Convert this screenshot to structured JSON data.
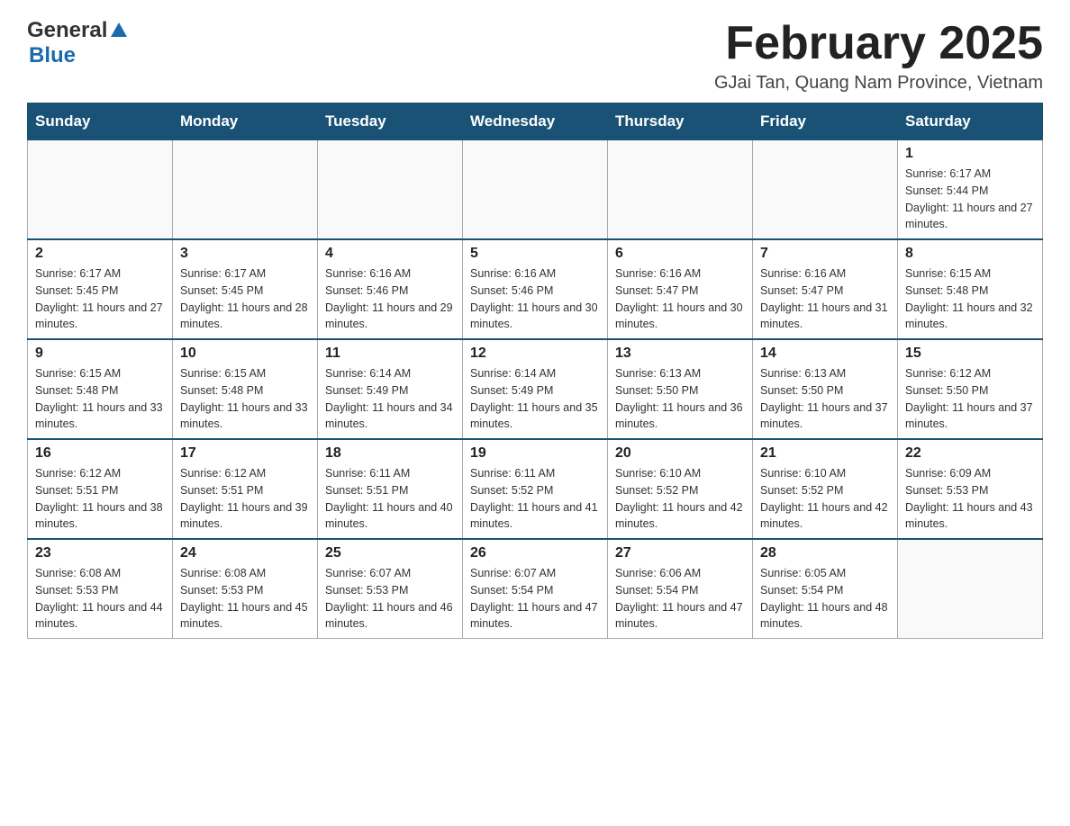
{
  "header": {
    "logo_general": "General",
    "logo_blue": "Blue",
    "title": "February 2025",
    "location": "GJai Tan, Quang Nam Province, Vietnam"
  },
  "days_of_week": [
    "Sunday",
    "Monday",
    "Tuesday",
    "Wednesday",
    "Thursday",
    "Friday",
    "Saturday"
  ],
  "weeks": [
    {
      "days": [
        {
          "number": "",
          "info": ""
        },
        {
          "number": "",
          "info": ""
        },
        {
          "number": "",
          "info": ""
        },
        {
          "number": "",
          "info": ""
        },
        {
          "number": "",
          "info": ""
        },
        {
          "number": "",
          "info": ""
        },
        {
          "number": "1",
          "info": "Sunrise: 6:17 AM\nSunset: 5:44 PM\nDaylight: 11 hours and 27 minutes."
        }
      ]
    },
    {
      "days": [
        {
          "number": "2",
          "info": "Sunrise: 6:17 AM\nSunset: 5:45 PM\nDaylight: 11 hours and 27 minutes."
        },
        {
          "number": "3",
          "info": "Sunrise: 6:17 AM\nSunset: 5:45 PM\nDaylight: 11 hours and 28 minutes."
        },
        {
          "number": "4",
          "info": "Sunrise: 6:16 AM\nSunset: 5:46 PM\nDaylight: 11 hours and 29 minutes."
        },
        {
          "number": "5",
          "info": "Sunrise: 6:16 AM\nSunset: 5:46 PM\nDaylight: 11 hours and 30 minutes."
        },
        {
          "number": "6",
          "info": "Sunrise: 6:16 AM\nSunset: 5:47 PM\nDaylight: 11 hours and 30 minutes."
        },
        {
          "number": "7",
          "info": "Sunrise: 6:16 AM\nSunset: 5:47 PM\nDaylight: 11 hours and 31 minutes."
        },
        {
          "number": "8",
          "info": "Sunrise: 6:15 AM\nSunset: 5:48 PM\nDaylight: 11 hours and 32 minutes."
        }
      ]
    },
    {
      "days": [
        {
          "number": "9",
          "info": "Sunrise: 6:15 AM\nSunset: 5:48 PM\nDaylight: 11 hours and 33 minutes."
        },
        {
          "number": "10",
          "info": "Sunrise: 6:15 AM\nSunset: 5:48 PM\nDaylight: 11 hours and 33 minutes."
        },
        {
          "number": "11",
          "info": "Sunrise: 6:14 AM\nSunset: 5:49 PM\nDaylight: 11 hours and 34 minutes."
        },
        {
          "number": "12",
          "info": "Sunrise: 6:14 AM\nSunset: 5:49 PM\nDaylight: 11 hours and 35 minutes."
        },
        {
          "number": "13",
          "info": "Sunrise: 6:13 AM\nSunset: 5:50 PM\nDaylight: 11 hours and 36 minutes."
        },
        {
          "number": "14",
          "info": "Sunrise: 6:13 AM\nSunset: 5:50 PM\nDaylight: 11 hours and 37 minutes."
        },
        {
          "number": "15",
          "info": "Sunrise: 6:12 AM\nSunset: 5:50 PM\nDaylight: 11 hours and 37 minutes."
        }
      ]
    },
    {
      "days": [
        {
          "number": "16",
          "info": "Sunrise: 6:12 AM\nSunset: 5:51 PM\nDaylight: 11 hours and 38 minutes."
        },
        {
          "number": "17",
          "info": "Sunrise: 6:12 AM\nSunset: 5:51 PM\nDaylight: 11 hours and 39 minutes."
        },
        {
          "number": "18",
          "info": "Sunrise: 6:11 AM\nSunset: 5:51 PM\nDaylight: 11 hours and 40 minutes."
        },
        {
          "number": "19",
          "info": "Sunrise: 6:11 AM\nSunset: 5:52 PM\nDaylight: 11 hours and 41 minutes."
        },
        {
          "number": "20",
          "info": "Sunrise: 6:10 AM\nSunset: 5:52 PM\nDaylight: 11 hours and 42 minutes."
        },
        {
          "number": "21",
          "info": "Sunrise: 6:10 AM\nSunset: 5:52 PM\nDaylight: 11 hours and 42 minutes."
        },
        {
          "number": "22",
          "info": "Sunrise: 6:09 AM\nSunset: 5:53 PM\nDaylight: 11 hours and 43 minutes."
        }
      ]
    },
    {
      "days": [
        {
          "number": "23",
          "info": "Sunrise: 6:08 AM\nSunset: 5:53 PM\nDaylight: 11 hours and 44 minutes."
        },
        {
          "number": "24",
          "info": "Sunrise: 6:08 AM\nSunset: 5:53 PM\nDaylight: 11 hours and 45 minutes."
        },
        {
          "number": "25",
          "info": "Sunrise: 6:07 AM\nSunset: 5:53 PM\nDaylight: 11 hours and 46 minutes."
        },
        {
          "number": "26",
          "info": "Sunrise: 6:07 AM\nSunset: 5:54 PM\nDaylight: 11 hours and 47 minutes."
        },
        {
          "number": "27",
          "info": "Sunrise: 6:06 AM\nSunset: 5:54 PM\nDaylight: 11 hours and 47 minutes."
        },
        {
          "number": "28",
          "info": "Sunrise: 6:05 AM\nSunset: 5:54 PM\nDaylight: 11 hours and 48 minutes."
        },
        {
          "number": "",
          "info": ""
        }
      ]
    }
  ]
}
